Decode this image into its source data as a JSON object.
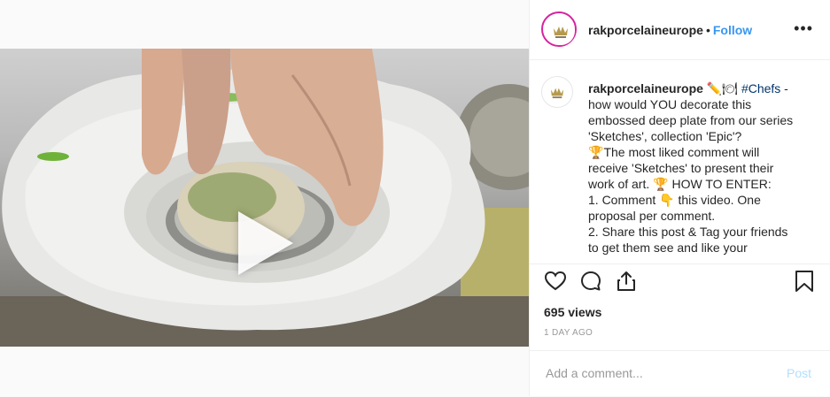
{
  "post": {
    "username": "rakporcelaineurope",
    "separator": "•",
    "follow_label": "Follow",
    "more_label": "•••",
    "caption": {
      "username": "rakporcelaineurope",
      "emoji_1": "✏️🍽",
      "hashtag": "#Chefs",
      "text_1": " - how would YOU decorate this embossed deep plate from our series 'Sketches', collection 'Epic'?",
      "emoji_trophy": "🏆",
      "text_2": "The most liked comment will receive 'Sketches' to present their work of art.",
      "text_3": " HOW TO ENTER:",
      "line_1a": "1. Comment ",
      "emoji_point": "👇",
      "line_1b": " this video. One proposal per comment.",
      "line_2": "2. Share this post & Tag your friends to get them see and like your"
    },
    "views": "695 views",
    "date": "1 DAY AGO",
    "comment_placeholder": "Add a comment...",
    "post_label": "Post"
  },
  "icons": {
    "like": "heart-icon",
    "comment": "comment-icon",
    "share": "share-icon",
    "save": "bookmark-icon",
    "play": "play-icon"
  },
  "colors": {
    "link": "#3897f0",
    "hashtag": "#003569",
    "avatar_ring": "#d6249f"
  }
}
